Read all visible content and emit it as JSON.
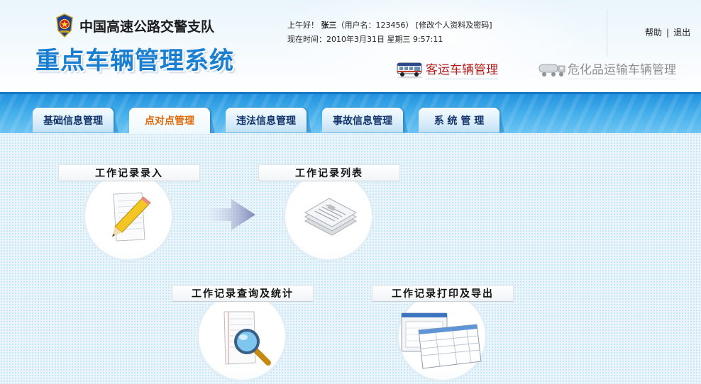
{
  "header": {
    "org_name": "中国高速公路交警支队",
    "system_title": "重点车辆管理系统",
    "greeting": "上午好！",
    "user_name": "张三",
    "username_prefix": "（用户名：",
    "username": "123456",
    "username_suffix": "）",
    "profile_link": "[修改个人资料及密码]",
    "time_label": "现在时间：",
    "time_value": "2010年3月31日 星期三 9:57:11",
    "help_label": "帮助",
    "separator": "|",
    "logout_label": "退出",
    "modes": [
      {
        "label": "客运车辆管理",
        "icon": "bus-icon",
        "active": true
      },
      {
        "label": "危化品运输车辆管理",
        "icon": "tanker-truck-icon",
        "active": false
      }
    ]
  },
  "nav": {
    "tabs": [
      {
        "label": "基础信息管理",
        "active": false
      },
      {
        "label": "点对点管理",
        "active": true
      },
      {
        "label": "违法信息管理",
        "active": false
      },
      {
        "label": "事故信息管理",
        "active": false
      },
      {
        "label": "系 统 管 理",
        "active": false
      }
    ]
  },
  "main": {
    "modules": [
      {
        "title": "工作记录录入",
        "icon": "pencil-paper-icon"
      },
      {
        "title": "工作记录列表",
        "icon": "document-stack-icon"
      },
      {
        "title": "工作记录查询及统计",
        "icon": "magnifier-document-icon"
      },
      {
        "title": "工作记录打印及导出",
        "icon": "print-export-icon"
      }
    ],
    "flow_arrow_icon": "right-arrow-icon"
  },
  "colors": {
    "nav_blue": "#2b9be3",
    "active_tab_text": "#e06a0a",
    "tab_text": "#12336b",
    "title_blue": "#1a7fd0",
    "passenger_red": "#b31b1b"
  }
}
